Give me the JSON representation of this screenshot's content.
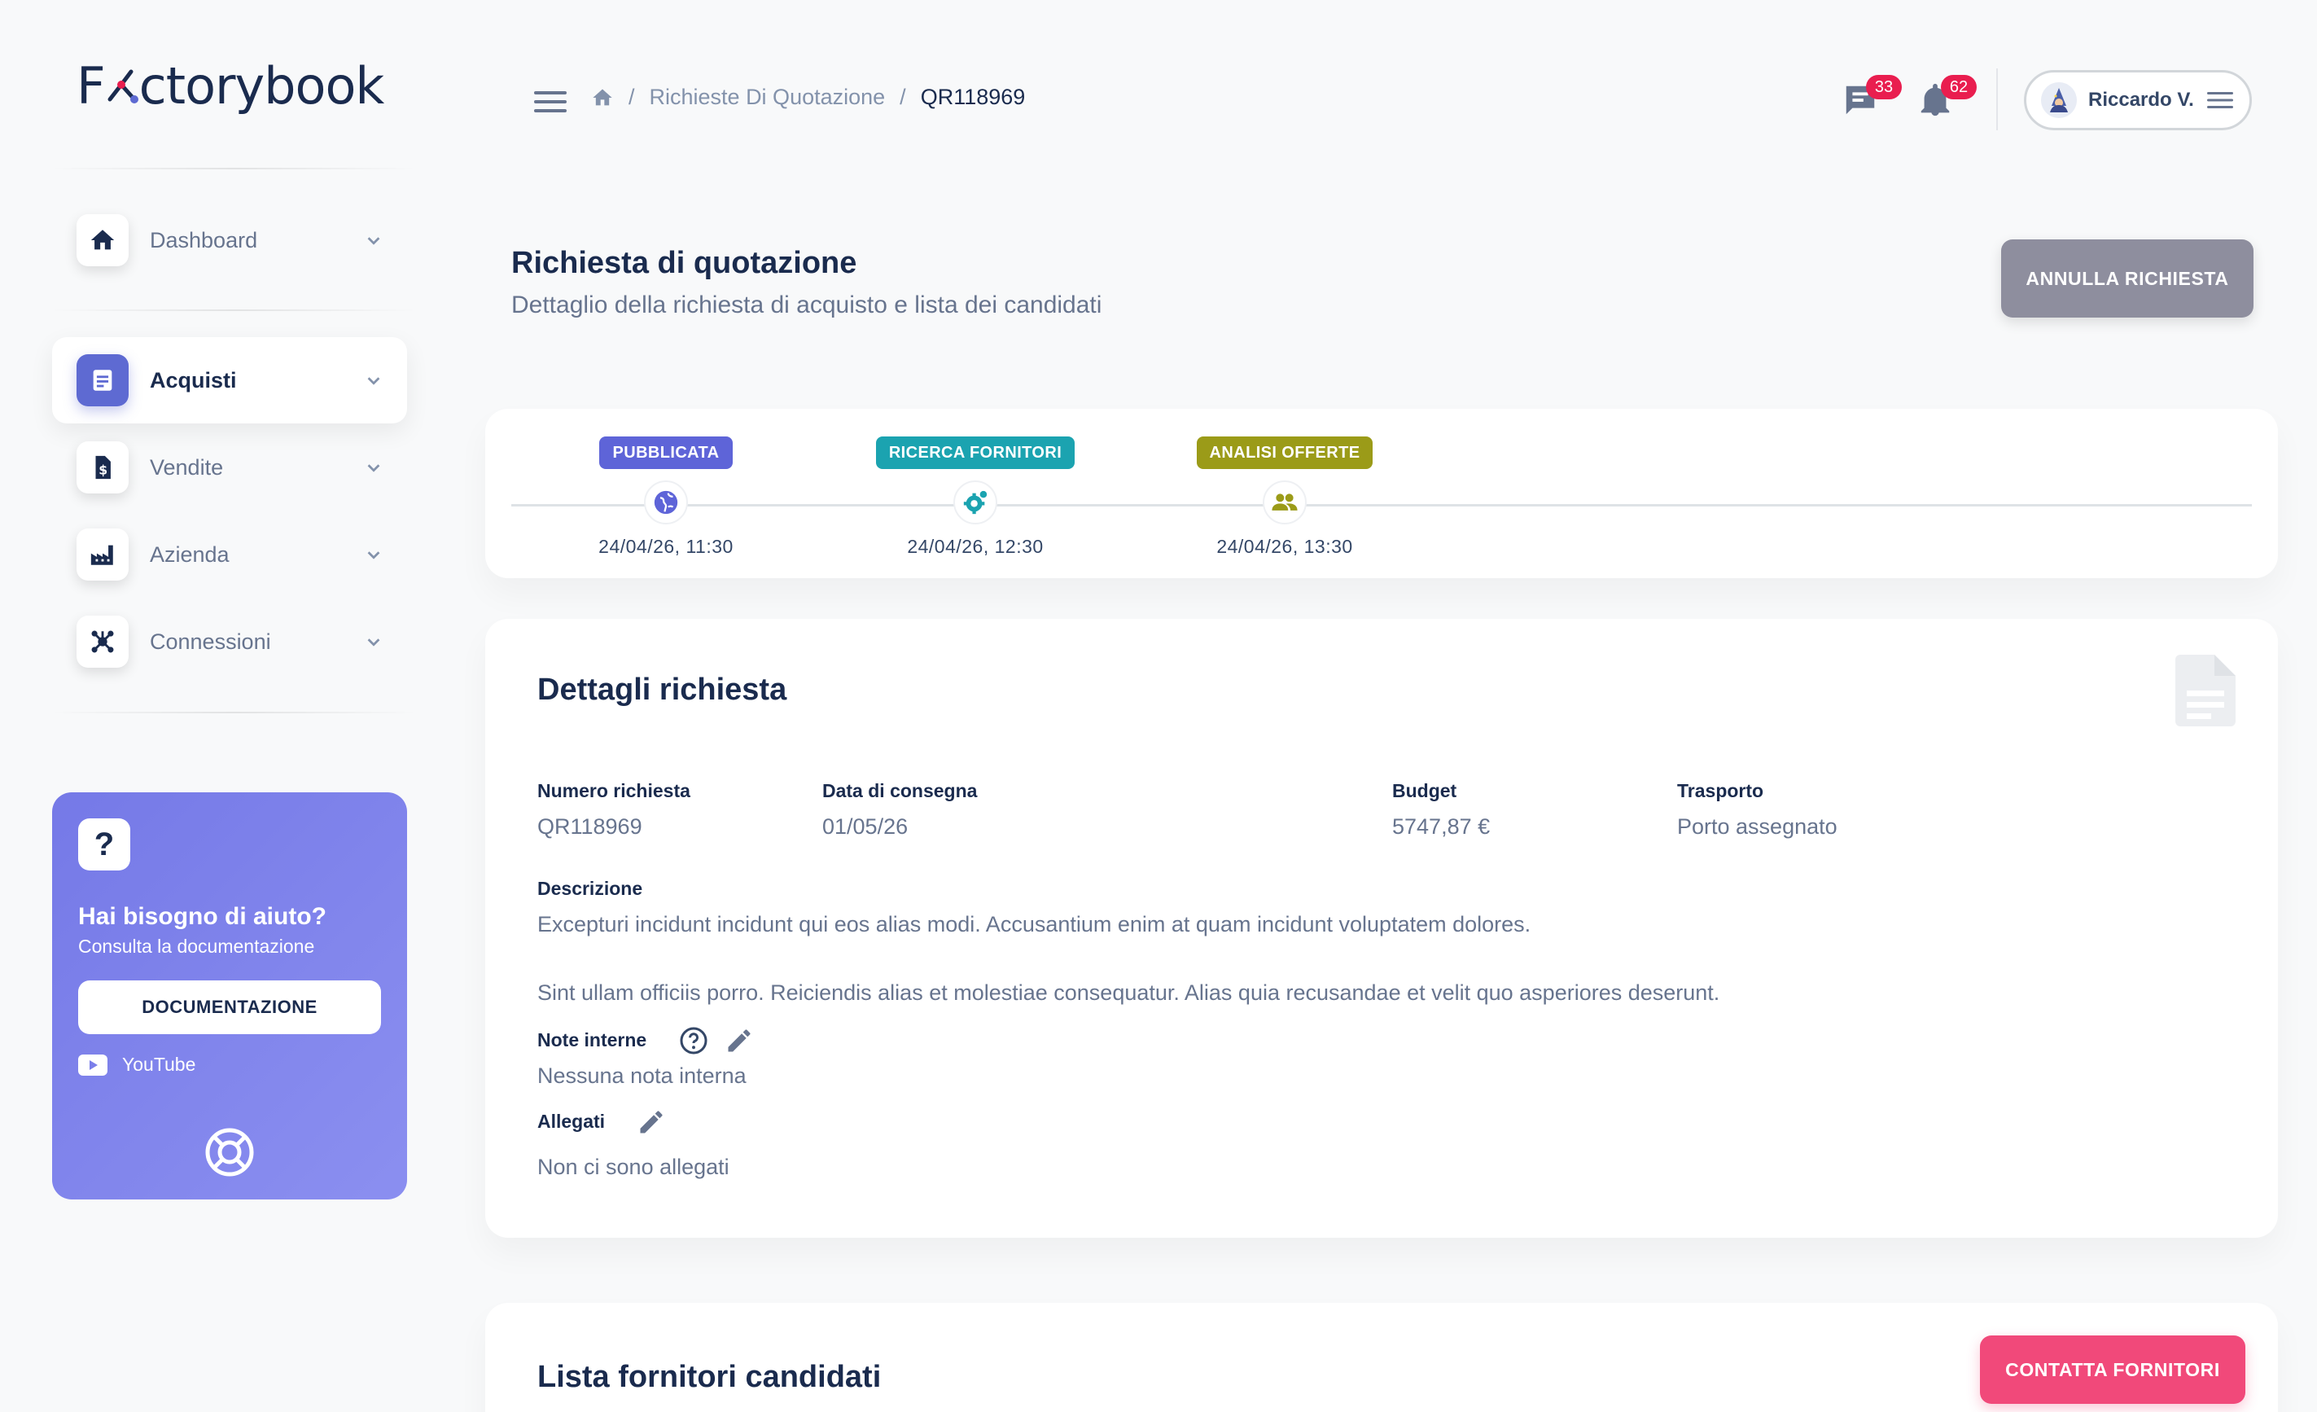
{
  "brand": {
    "name_left": "F",
    "name_right": "ctorybook"
  },
  "sidebar": {
    "items": [
      {
        "label": "Dashboard",
        "icon": "home-icon",
        "active": false
      },
      {
        "label": "Acquisti",
        "icon": "document-icon",
        "active": true
      },
      {
        "label": "Vendite",
        "icon": "invoice-dollar-icon",
        "active": false
      },
      {
        "label": "Azienda",
        "icon": "factory-icon",
        "active": false
      },
      {
        "label": "Connessioni",
        "icon": "network-icon",
        "active": false
      }
    ],
    "help": {
      "icon_text": "?",
      "title": "Hai bisogno di aiuto?",
      "subtitle": "Consulta la documentazione",
      "button": "DOCUMENTAZIONE",
      "youtube": "YouTube"
    }
  },
  "header": {
    "breadcrumb": {
      "section": "Richieste Di Quotazione",
      "separator": "/",
      "current": "QR118969"
    },
    "messages_count": "33",
    "notifications_count": "62",
    "user_name": "Riccardo V."
  },
  "page": {
    "title": "Richiesta di quotazione",
    "subtitle": "Dettaglio della richiesta di acquisto e lista dei candidati",
    "cancel_button": "ANNULLA RICHIESTA"
  },
  "timeline": [
    {
      "label": "PUBBLICATA",
      "date": "24/04/26, 11:30",
      "color": "#5e64d8",
      "icon": "globe-icon"
    },
    {
      "label": "RICERCA FORNITORI",
      "date": "24/04/26, 12:30",
      "color": "#1ba3b0",
      "icon": "gear-search-icon"
    },
    {
      "label": "ANALISI OFFERTE",
      "date": "24/04/26, 13:30",
      "color": "#9b9b18",
      "icon": "people-icon"
    }
  ],
  "details": {
    "title": "Dettagli richiesta",
    "numero_label": "Numero richiesta",
    "numero_value": "QR118969",
    "consegna_label": "Data di consegna",
    "consegna_value": "01/05/26",
    "budget_label": "Budget",
    "budget_value": "5747,87 €",
    "trasporto_label": "Trasporto",
    "trasporto_value": "Porto assegnato",
    "descrizione_label": "Descrizione",
    "descrizione_p1": "Excepturi incidunt incidunt qui eos alias modi. Accusantium enim at quam incidunt voluptatem dolores.",
    "descrizione_p2": "Sint ullam officiis porro. Reiciendis alias et molestiae consequatur. Alias quia recusandae et velit quo asperiores deserunt.",
    "note_label": "Note interne",
    "note_value": "Nessuna nota interna",
    "allegati_label": "Allegati",
    "allegati_value": "Non ci sono allegati"
  },
  "suppliers": {
    "title": "Lista fornitori candidati",
    "contact_button": "CONTATTA FORNITORI"
  }
}
